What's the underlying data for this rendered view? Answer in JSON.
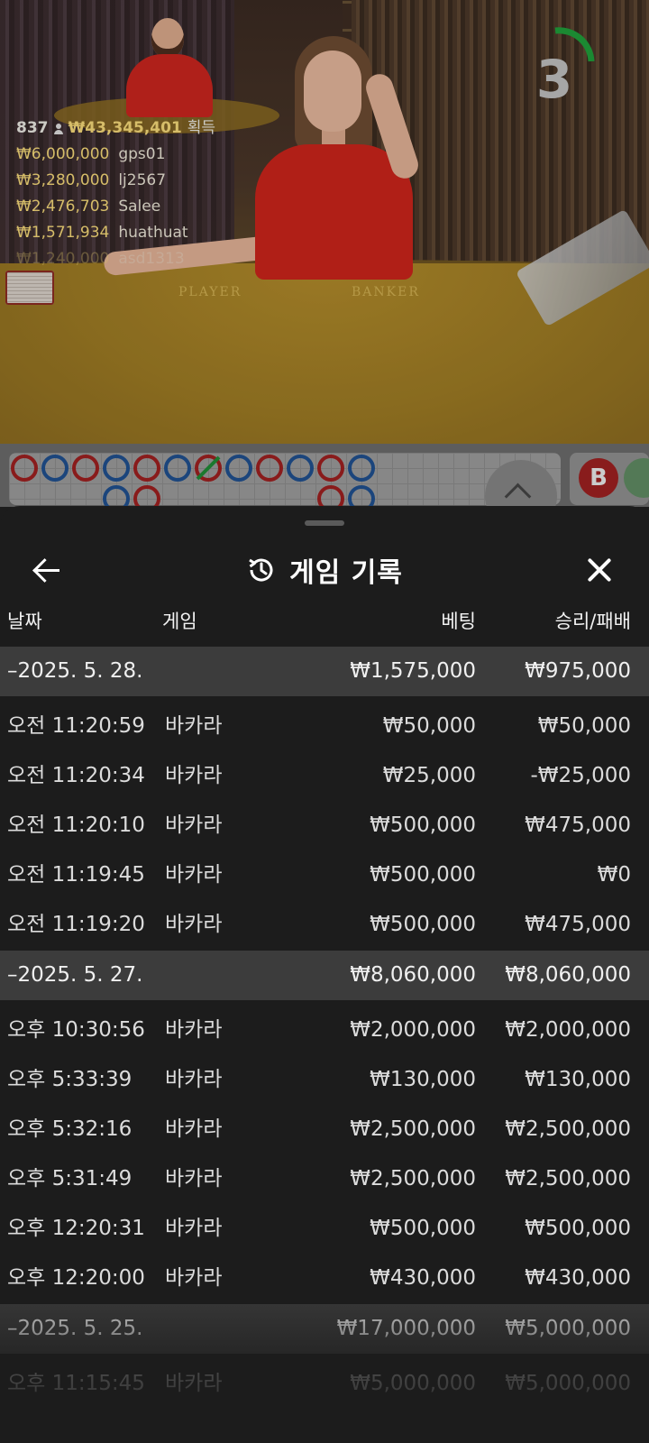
{
  "video": {
    "table_player_label": "PLAYER",
    "table_banker_label": "BANKER",
    "timer_value": "3",
    "timer_color": "#1f9d3a"
  },
  "overlay": {
    "player_count": "837",
    "total_win": "₩43,345,401",
    "total_win_label": "획득",
    "winners": [
      {
        "amount": "₩6,000,000",
        "name": "gps01"
      },
      {
        "amount": "₩3,280,000",
        "name": "lj2567"
      },
      {
        "amount": "₩2,476,703",
        "name": "Salee"
      },
      {
        "amount": "₩1,571,934",
        "name": "huathuat"
      },
      {
        "amount": "₩1,240,000",
        "name": "asd1313"
      }
    ]
  },
  "roadmap": {
    "banker_button": "B",
    "top_row": [
      "red",
      "blue",
      "red",
      "blue",
      "red",
      "blue-tie",
      "red-tie",
      "blue",
      "red",
      "blue",
      "red",
      "blue"
    ],
    "second_row": [
      "",
      "",
      "",
      "blue",
      "red",
      "",
      "",
      "",
      "",
      "",
      "red",
      "blue"
    ]
  },
  "sheet": {
    "title": "게임 기록",
    "back_icon": "back-arrow-icon",
    "history_icon": "history-icon",
    "close_icon": "close-icon",
    "columns": {
      "date": "날짜",
      "game": "게임",
      "bet": "베팅",
      "result": "승리/패배"
    },
    "groups": [
      {
        "date": "–2025. 5. 28.",
        "bet_total": "₩1,575,000",
        "result_total": "₩975,000",
        "rows": [
          {
            "time": "오전 11:20:59",
            "game": "바카라",
            "bet": "₩50,000",
            "result": "₩50,000"
          },
          {
            "time": "오전 11:20:34",
            "game": "바카라",
            "bet": "₩25,000",
            "result": "-₩25,000"
          },
          {
            "time": "오전 11:20:10",
            "game": "바카라",
            "bet": "₩500,000",
            "result": "₩475,000"
          },
          {
            "time": "오전 11:19:45",
            "game": "바카라",
            "bet": "₩500,000",
            "result": "₩0"
          },
          {
            "time": "오전 11:19:20",
            "game": "바카라",
            "bet": "₩500,000",
            "result": "₩475,000"
          }
        ]
      },
      {
        "date": "–2025. 5. 27.",
        "bet_total": "₩8,060,000",
        "result_total": "₩8,060,000",
        "rows": [
          {
            "time": "오후 10:30:56",
            "game": "바카라",
            "bet": "₩2,000,000",
            "result": "₩2,000,000"
          },
          {
            "time": "오후 5:33:39",
            "game": "바카라",
            "bet": "₩130,000",
            "result": "₩130,000"
          },
          {
            "time": "오후 5:32:16",
            "game": "바카라",
            "bet": "₩2,500,000",
            "result": "₩2,500,000"
          },
          {
            "time": "오후 5:31:49",
            "game": "바카라",
            "bet": "₩2,500,000",
            "result": "₩2,500,000"
          },
          {
            "time": "오후 12:20:31",
            "game": "바카라",
            "bet": "₩500,000",
            "result": "₩500,000"
          },
          {
            "time": "오후 12:20:00",
            "game": "바카라",
            "bet": "₩430,000",
            "result": "₩430,000"
          }
        ]
      },
      {
        "date": "–2025. 5. 25.",
        "bet_total": "₩17,000,000",
        "result_total": "₩5,000,000",
        "rows": [
          {
            "time": "오후 11:15:45",
            "game": "바카라",
            "bet": "₩5,000,000",
            "result": "₩5,000,000"
          }
        ]
      }
    ]
  }
}
